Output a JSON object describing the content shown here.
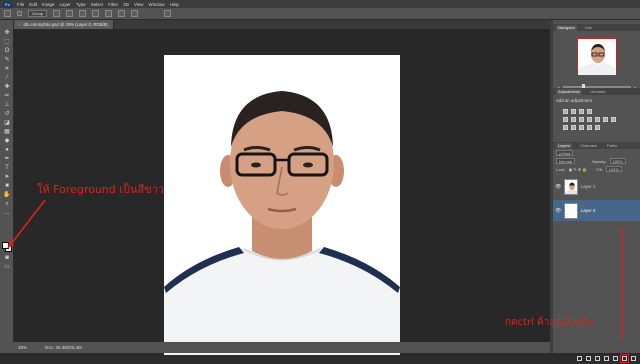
{
  "menubar": {
    "logo": "Ps",
    "items": [
      "File",
      "Edit",
      "Image",
      "Layer",
      "Type",
      "Select",
      "Filter",
      "3D",
      "View",
      "Window",
      "Help"
    ]
  },
  "options": {
    "auto_select_value": "Group"
  },
  "document": {
    "tab_title": "dlc-cut-myfoto.psd @ 25% (Layer 0, RGB/8)",
    "close_glyph": "×"
  },
  "status": {
    "zoom": "25%",
    "doc_size": "Doc: 26.4M/23.4M"
  },
  "panels": {
    "navigator_tab": "Navigator",
    "info_tab": "Info",
    "adjustments_tab": "Adjustments",
    "libraries_tab": "Libraries",
    "add_adjustment": "Add an adjustment",
    "layers_tab": "Layers",
    "channels_tab": "Channels",
    "paths_tab": "Paths",
    "kind_filter": "ρ Kind",
    "blend_mode": "Normal",
    "opacity_label": "Opacity:",
    "opacity_value": "100%",
    "lock_label": "Lock:",
    "fill_label": "Fill:",
    "fill_value": "100%",
    "layers": [
      {
        "name": "Layer 1",
        "selected": false
      },
      {
        "name": "Layer 0",
        "selected": true
      }
    ]
  },
  "annotations": {
    "foreground_note": "ให้ Foreground เป็นสีขาว",
    "ctrl_note": "กดctrl ค้าง แล้วคลิก"
  },
  "colors": {
    "annotation": "#e0201f",
    "selected_layer": "#46668a",
    "panel_bg": "#535353",
    "canvas_bg": "#282828"
  }
}
